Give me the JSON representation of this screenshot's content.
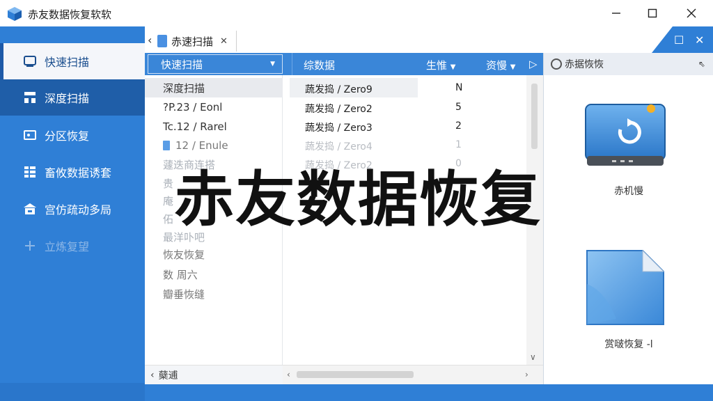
{
  "window": {
    "title": "赤友数据恢复软软",
    "minimize_glyph": "—",
    "maximize_glyph": "☐",
    "close_glyph": "✕"
  },
  "sidebar": {
    "items": [
      {
        "label": "快速扫描",
        "icon": "drive-icon"
      },
      {
        "label": "深度扫描",
        "icon": "network-icon"
      },
      {
        "label": "分区恢复",
        "icon": "partition-icon"
      },
      {
        "label": "畜攸数据诱套",
        "icon": "grid-icon"
      },
      {
        "label": "宫仿疏动多局",
        "icon": "home-icon"
      },
      {
        "label": "立炼复望",
        "icon": "plus-icon"
      }
    ]
  },
  "tabs": {
    "back_glyph": "‹",
    "active_label": "赤速扫描",
    "close_glyph": "✕",
    "corner_restore": "☐",
    "corner_close": "✕"
  },
  "columns": {
    "scan_mode": "快速扫描",
    "name": "综数据",
    "status": "生惟",
    "size": "资慢",
    "more": "▷"
  },
  "tree": {
    "items": [
      {
        "label": "深度扫描"
      },
      {
        "label": "?P.23 / Eonl"
      },
      {
        "label": "Tc.12 / Rarel"
      },
      {
        "label": "12 / Enule"
      },
      {
        "label": "蘧迭商连搭"
      },
      {
        "label": "贵"
      },
      {
        "label": "庵"
      },
      {
        "label": "佦"
      },
      {
        "label": "最洋卟吧"
      },
      {
        "label": "恢友恢复"
      },
      {
        "label": "数 周六"
      },
      {
        "label": "瓣垂恢缝"
      }
    ],
    "bottom_arrow": "‹",
    "bottom_label": "蘖逋"
  },
  "files": {
    "rows": [
      {
        "name": "蔬发捣 / Zero9",
        "value": "N"
      },
      {
        "name": "蔬发捣 / Zero2",
        "value": "5"
      },
      {
        "name": "蔬发捣 / Zero3",
        "value": "2"
      },
      {
        "name": "蔬发捣 / Zero4",
        "value": "1"
      },
      {
        "name": "蔬发捣 / Zero2",
        "value": "0"
      }
    ]
  },
  "preview": {
    "title": "赤据恢恢",
    "pin_glyph": "⇖",
    "device_caption": "赤机慢",
    "file_caption": "赏啵恢复 -l"
  },
  "overlay": {
    "title": "赤友数据恢复"
  },
  "colors": {
    "sidebar_bg": "#2f7fd6",
    "sidebar_hover": "#1f5ea8",
    "column_bar": "#3a86d8",
    "accent": "#4a90e2"
  }
}
